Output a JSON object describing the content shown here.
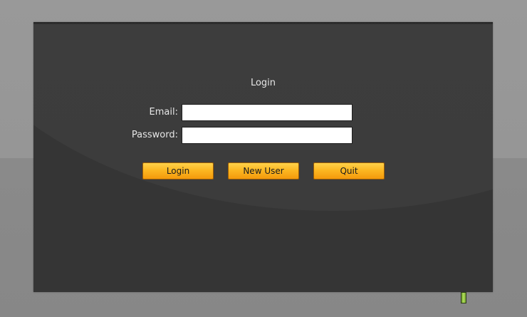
{
  "login": {
    "title": "Login",
    "email_label": "Email:",
    "email_value": "",
    "password_label": "Password:",
    "password_value": "",
    "buttons": {
      "login": "Login",
      "new_user": "New User",
      "quit": "Quit"
    }
  },
  "colors": {
    "panel": "#353535",
    "button_accent": "#fcb722",
    "indicator": "#8cc63f"
  },
  "icons": {
    "status_indicator": "status-light-icon"
  }
}
